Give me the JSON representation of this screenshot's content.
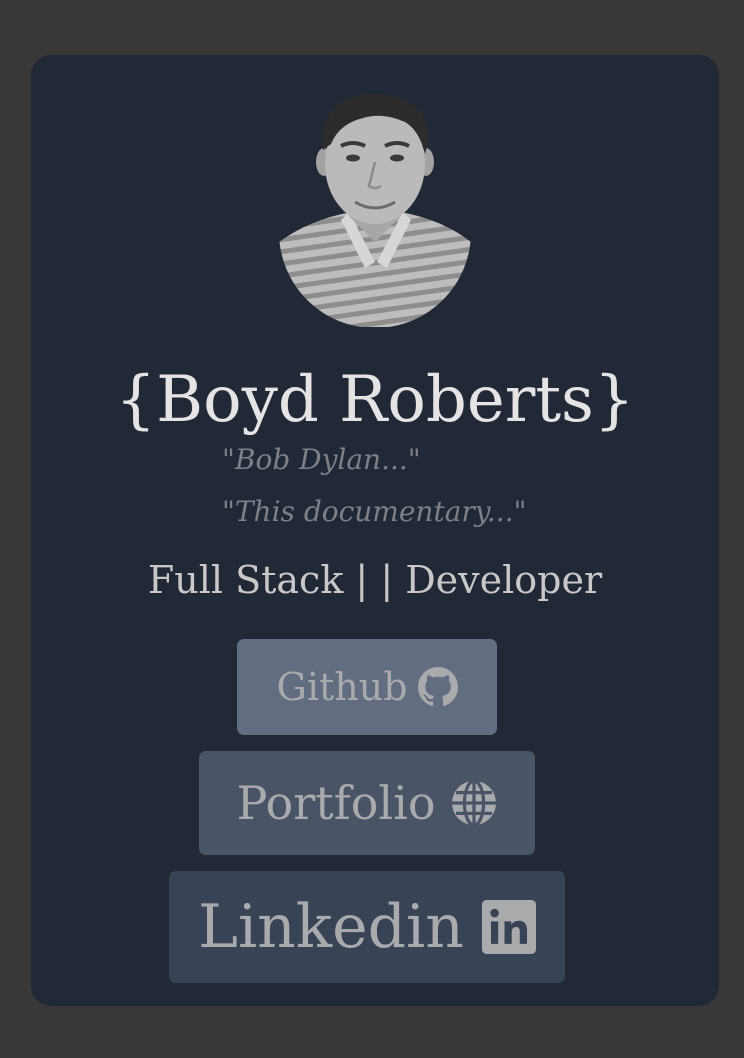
{
  "profile": {
    "name": "{Boyd Roberts}",
    "quotes": [
      "\"Bob Dylan...\"",
      "\"This documentary...\""
    ],
    "role": "Full Stack | | Developer"
  },
  "links": {
    "github_label": "Github",
    "portfolio_label": "Portfolio",
    "linkedin_label": "Linkedin"
  },
  "icons": {
    "github": "github-icon",
    "portfolio": "globe-icon",
    "linkedin": "linkedin-icon"
  },
  "colors": {
    "page_background": "#383838",
    "card_background": "#222936",
    "github_button": "#636d82",
    "portfolio_button": "#4a5467",
    "linkedin_button": "#384355",
    "button_text": "#a9aaac"
  }
}
